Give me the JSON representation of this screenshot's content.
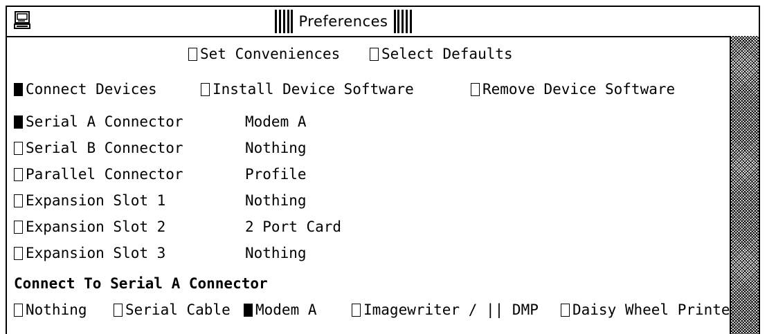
{
  "window": {
    "title": "Preferences"
  },
  "top_tabs": [
    {
      "label": "Set Conveniences",
      "checked": false
    },
    {
      "label": "Select Defaults",
      "checked": false
    }
  ],
  "sub_tabs": [
    {
      "label": "Connect Devices",
      "checked": true
    },
    {
      "label": "Install Device Software",
      "checked": false
    },
    {
      "label": "Remove Device Software",
      "checked": false
    }
  ],
  "connectors": [
    {
      "label": "Serial A Connector",
      "value": "Modem A",
      "checked": true
    },
    {
      "label": "Serial B Connector",
      "value": "Nothing",
      "checked": false
    },
    {
      "label": "Parallel Connector",
      "value": "Profile",
      "checked": false
    },
    {
      "label": "Expansion Slot 1",
      "value": "Nothing",
      "checked": false
    },
    {
      "label": "Expansion Slot 2",
      "value": "2 Port Card",
      "checked": false
    },
    {
      "label": "Expansion Slot 3",
      "value": "Nothing",
      "checked": false
    }
  ],
  "connect_to": {
    "title": "Connect To Serial A Connector",
    "options": [
      {
        "label": "Nothing",
        "checked": false
      },
      {
        "label": "Serial Cable",
        "checked": false
      },
      {
        "label": "Modem A",
        "checked": true
      },
      {
        "label": "Imagewriter / || DMP",
        "checked": false
      },
      {
        "label": "Daisy Wheel Printer",
        "checked": false
      }
    ]
  },
  "colors": {
    "foreground": "#000000",
    "background": "#ffffff"
  }
}
